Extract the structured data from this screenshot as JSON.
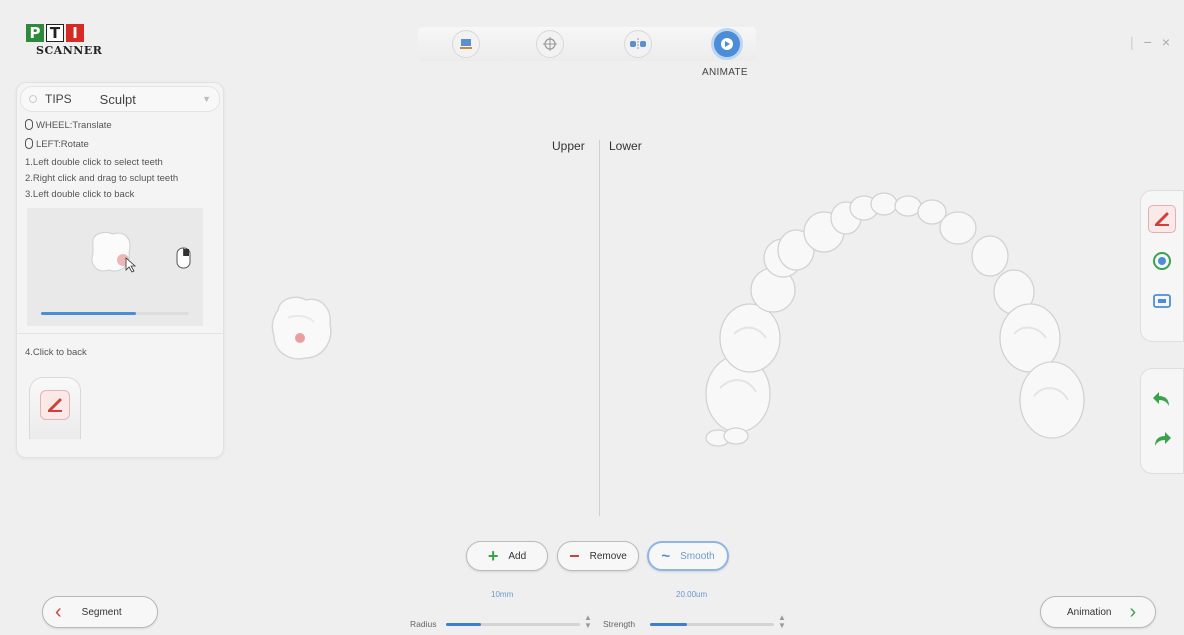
{
  "app": {
    "logo_letters": [
      "P",
      "T",
      "I"
    ],
    "logo_sub": "SCANNER"
  },
  "toolbar": {
    "buttons": [
      {
        "icon": "scan-device-icon"
      },
      {
        "icon": "target-icon"
      },
      {
        "icon": "teeth-segment-icon"
      },
      {
        "icon": "play-icon",
        "label": "ANIMATE",
        "active": true
      }
    ]
  },
  "window": {
    "minimize": "−",
    "close": "×"
  },
  "tips": {
    "header": "TIPS",
    "mode": "Sculpt",
    "lines": {
      "wheel": "WHEEL:Translate",
      "left": "LEFT:Rotate",
      "step1": "1.Left double click to select teeth",
      "step2": "2.Right click and drag to sclupt teeth",
      "step3": "3.Left double click to back",
      "step4": "4.Click to back"
    },
    "preview_slider_level": 0.64
  },
  "view": {
    "upper_label": "Upper",
    "lower_label": "Lower"
  },
  "sculpt": {
    "add_label": "Add",
    "remove_label": "Remove",
    "smooth_label": "Smooth",
    "active_tool": "Smooth",
    "radius_label": "Radius",
    "radius_value": "10mm",
    "radius_level": 0.26,
    "strength_label": "Strength",
    "strength_value": "20.00um",
    "strength_level": 0.3
  },
  "nav": {
    "back_label": "Segment",
    "next_label": "Animation"
  },
  "colors": {
    "accent": "#4b8dd6",
    "green": "#3aa24a",
    "red": "#d0403a"
  }
}
